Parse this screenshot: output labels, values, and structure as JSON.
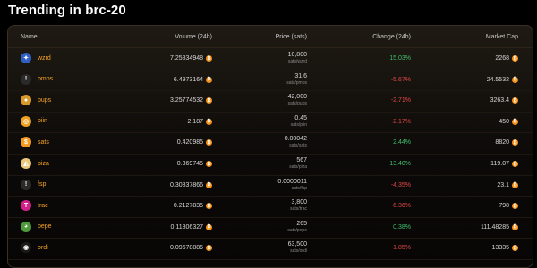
{
  "page": {
    "title": "Trending in brc-20"
  },
  "table": {
    "headers": {
      "name": "Name",
      "volume": "Volume (24h)",
      "price": "Price (sats)",
      "change": "Change (24h)",
      "cap": "Market Cap"
    },
    "rows": [
      {
        "ticker": "wzrd",
        "volume": "7.25834948",
        "price": "10,800",
        "price_unit": "sats/wzrd",
        "change": "15.03%",
        "dir": "pos",
        "cap": "2268",
        "icon": "wizard-avatar",
        "color": "#2f5fc2",
        "glyph": "✦"
      },
      {
        "ticker": "pmps",
        "volume": "6.4973164",
        "price": "31.6",
        "price_unit": "sats/pmps",
        "change": "-5.67%",
        "dir": "neg",
        "cap": "24.5532",
        "icon": "info-circle-icon",
        "color": "#2a2a2a",
        "glyph": "!"
      },
      {
        "ticker": "pups",
        "volume": "3.25774532",
        "price": "42,000",
        "price_unit": "sats/pups",
        "change": "-2.71%",
        "dir": "neg",
        "cap": "3263.4",
        "icon": "dog-avatar",
        "color": "#d89a2a",
        "glyph": "●"
      },
      {
        "ticker": "piin",
        "volume": "2.187",
        "price": "0.45",
        "price_unit": "sats/piin",
        "change": "-2.17%",
        "dir": "neg",
        "cap": "450",
        "icon": "piin-coin-icon",
        "color": "#f0a020",
        "glyph": "◎"
      },
      {
        "ticker": "sats",
        "volume": "0.420985",
        "price": "0.00042",
        "price_unit": "sats/sats",
        "change": "2.44%",
        "dir": "pos",
        "cap": "8820",
        "icon": "dollar-coin-icon",
        "color": "#f39a1f",
        "glyph": "$"
      },
      {
        "ticker": "piza",
        "volume": "0.369745",
        "price": "567",
        "price_unit": "sats/piza",
        "change": "13.40%",
        "dir": "pos",
        "cap": "119.07",
        "icon": "pizza-avatar",
        "color": "#e9c87a",
        "glyph": "◭"
      },
      {
        "ticker": "fsp",
        "volume": "0.30837866",
        "price": "0.0000011",
        "price_unit": "sats/fsp",
        "change": "-4.35%",
        "dir": "neg",
        "cap": "23.1",
        "icon": "info-circle-icon",
        "color": "#2a2a2a",
        "glyph": "!"
      },
      {
        "ticker": "trac",
        "volume": "0.2127835",
        "price": "3,800",
        "price_unit": "sats/trac",
        "change": "-6.36%",
        "dir": "neg",
        "cap": "798",
        "icon": "trac-logo-icon",
        "color": "#d0208a",
        "glyph": "T"
      },
      {
        "ticker": "pepe",
        "volume": "0.11806327",
        "price": "265",
        "price_unit": "sats/pepe",
        "change": "0.38%",
        "dir": "pos",
        "cap": "111.48285",
        "icon": "frog-avatar",
        "color": "#4c9a3a",
        "glyph": "◕"
      },
      {
        "ticker": "ordi",
        "volume": "0.09678886",
        "price": "63,500",
        "price_unit": "sats/ordi",
        "change": "-1.85%",
        "dir": "neg",
        "cap": "13335",
        "icon": "ordi-logo-icon",
        "color": "#1a1a1a",
        "glyph": "◉"
      }
    ]
  },
  "colors": {
    "ticker": "#f7a325",
    "positive": "#3fbf6e",
    "negative": "#e04848",
    "btc": "#f7931a"
  },
  "btc_glyph": "₿"
}
